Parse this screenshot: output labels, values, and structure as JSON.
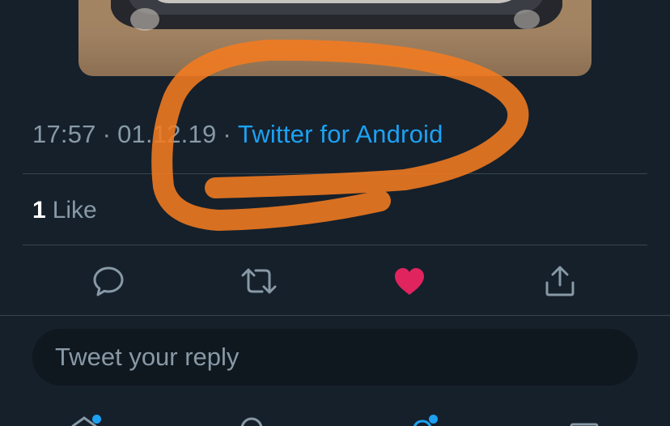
{
  "tweet": {
    "time": "17:57",
    "date": "01.12.19",
    "separator": "·",
    "source": "Twitter for Android"
  },
  "engagement": {
    "like_count": "1",
    "like_label": "Like"
  },
  "actions": {
    "reply_icon": "comment-icon",
    "retweet_icon": "retweet-icon",
    "like_icon": "heart-icon",
    "like_active": true,
    "share_icon": "share-icon"
  },
  "reply": {
    "placeholder": "Tweet your reply"
  },
  "bottom_nav": {
    "items": [
      "home-icon",
      "search-icon",
      "notifications-icon",
      "messages-icon"
    ]
  },
  "colors": {
    "background": "#15202b",
    "secondary_text": "#8899a6",
    "accent": "#1da1f2",
    "like_active": "#e0245e",
    "divider": "#38444d",
    "annotation": "#f47b20"
  }
}
